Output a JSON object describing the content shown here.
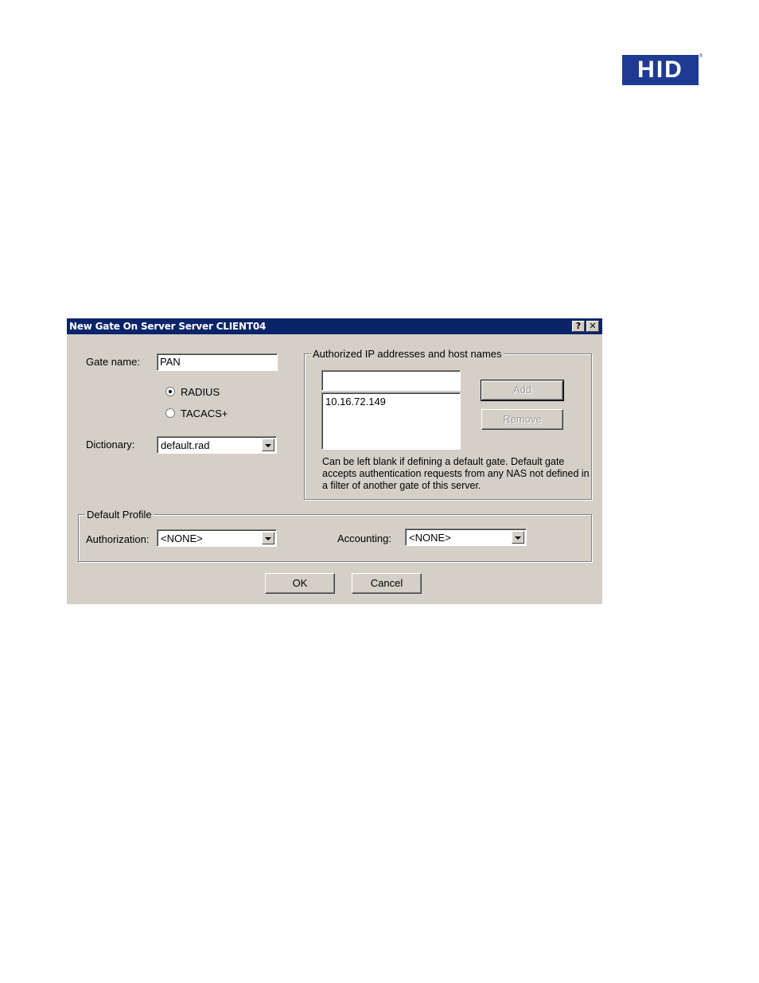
{
  "logo": {
    "text": "HID",
    "reg": "®"
  },
  "dialog": {
    "title": "New Gate On Server Server CLIENT04",
    "help_btn": "?",
    "close_btn": "✕",
    "gate_name_label": "Gate name:",
    "gate_name_value": "PAN",
    "protocol_options": [
      {
        "label": "RADIUS",
        "checked": true
      },
      {
        "label": "TACACS+",
        "checked": false
      }
    ],
    "dictionary_label": "Dictionary:",
    "dictionary_value": "default.rad",
    "authorized_group_title": "Authorized IP addresses and host names",
    "authorized_input_value": "",
    "authorized_list": [
      "10.16.72.149"
    ],
    "add_label": "Add",
    "remove_label": "Remove",
    "hint": "Can be left blank if defining a default gate. Default gate accepts authentication requests from any NAS not defined in a filter of another gate of this server.",
    "default_profile_title": "Default Profile",
    "authorization_label": "Authorization:",
    "authorization_value": "<NONE>",
    "accounting_label": "Accounting:",
    "accounting_value": "<NONE>",
    "ok_label": "OK",
    "cancel_label": "Cancel"
  }
}
